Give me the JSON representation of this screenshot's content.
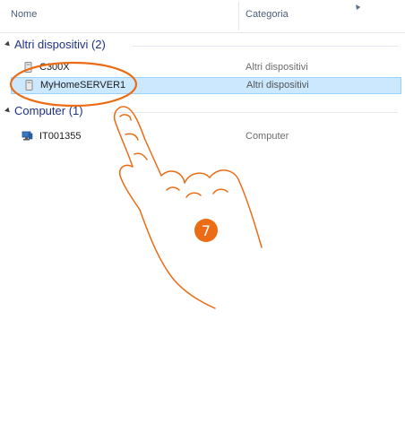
{
  "columns": {
    "name": "Nome",
    "category": "Categoria"
  },
  "groups": [
    {
      "title": "Altri dispositivi (2)",
      "items": [
        {
          "name": "C300X",
          "category": "Altri dispositivi",
          "icon": "device-icon",
          "selected": false
        },
        {
          "name": "MyHomeSERVER1",
          "category": "Altri dispositivi",
          "icon": "device-icon",
          "selected": true
        }
      ]
    },
    {
      "title": "Computer (1)",
      "items": [
        {
          "name": "IT001355",
          "category": "Computer",
          "icon": "computer-icon",
          "selected": false
        }
      ]
    }
  ],
  "annotation": {
    "step_number": "7",
    "accent_color": "#ec6b15",
    "selected_bg": "#cce8ff",
    "group_color": "#1e3287"
  }
}
